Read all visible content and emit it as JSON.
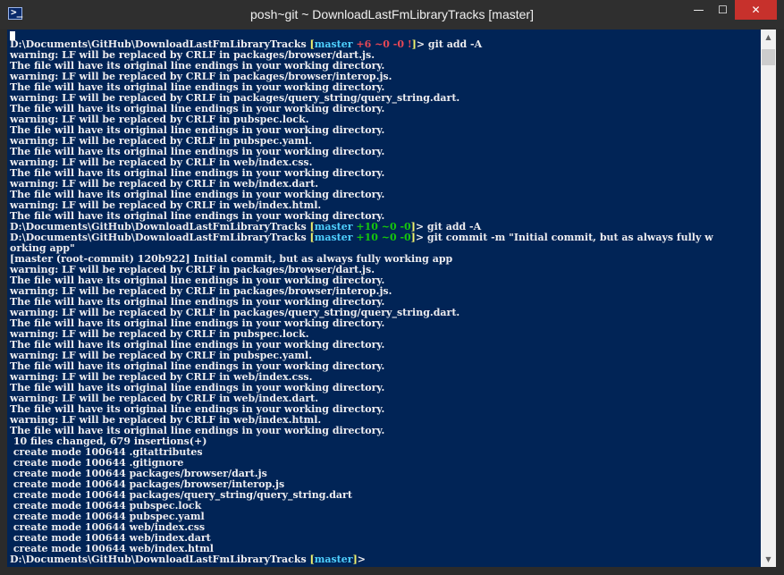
{
  "window": {
    "title": "posh~git ~ DownloadLastFmLibraryTracks [master]",
    "icon": "powershell-icon",
    "icon_glyph": ">_",
    "min_glyph": "—",
    "max_glyph": "☐",
    "close_glyph": "✕"
  },
  "colors": {
    "console_bg": "#012456",
    "text": "#eeedf0",
    "bracket_yellow": "#f2f26c",
    "branch_cyan": "#4fd0ff",
    "added_green": "#16c60c",
    "deleted_red": "#e74856"
  },
  "terminal": {
    "lines": [
      [
        {
          "t": "D:\\Documents\\GitHub\\DownloadLastFmLibraryTracks "
        },
        {
          "t": "[",
          "c": "yel"
        },
        {
          "t": "master",
          "c": "cyan"
        },
        {
          "t": " +6 ~0 -0 !",
          "c": "red"
        },
        {
          "t": "]",
          "c": "yel"
        },
        {
          "t": "> git add -A"
        }
      ],
      [
        {
          "t": "warning: LF will be replaced by CRLF in packages/browser/dart.js."
        }
      ],
      [
        {
          "t": "The file will have its original line endings in your working directory."
        }
      ],
      [
        {
          "t": "warning: LF will be replaced by CRLF in packages/browser/interop.js."
        }
      ],
      [
        {
          "t": "The file will have its original line endings in your working directory."
        }
      ],
      [
        {
          "t": "warning: LF will be replaced by CRLF in packages/query_string/query_string.dart."
        }
      ],
      [
        {
          "t": "The file will have its original line endings in your working directory."
        }
      ],
      [
        {
          "t": "warning: LF will be replaced by CRLF in pubspec.lock."
        }
      ],
      [
        {
          "t": "The file will have its original line endings in your working directory."
        }
      ],
      [
        {
          "t": "warning: LF will be replaced by CRLF in pubspec.yaml."
        }
      ],
      [
        {
          "t": "The file will have its original line endings in your working directory."
        }
      ],
      [
        {
          "t": "warning: LF will be replaced by CRLF in web/index.css."
        }
      ],
      [
        {
          "t": "The file will have its original line endings in your working directory."
        }
      ],
      [
        {
          "t": "warning: LF will be replaced by CRLF in web/index.dart."
        }
      ],
      [
        {
          "t": "The file will have its original line endings in your working directory."
        }
      ],
      [
        {
          "t": "warning: LF will be replaced by CRLF in web/index.html."
        }
      ],
      [
        {
          "t": "The file will have its original line endings in your working directory."
        }
      ],
      [
        {
          "t": "D:\\Documents\\GitHub\\DownloadLastFmLibraryTracks "
        },
        {
          "t": "[",
          "c": "yel"
        },
        {
          "t": "master",
          "c": "cyan"
        },
        {
          "t": " +10 ~0 -0",
          "c": "grn"
        },
        {
          "t": "]",
          "c": "yel"
        },
        {
          "t": "> git add -A"
        }
      ],
      [
        {
          "t": "D:\\Documents\\GitHub\\DownloadLastFmLibraryTracks "
        },
        {
          "t": "[",
          "c": "yel"
        },
        {
          "t": "master",
          "c": "cyan"
        },
        {
          "t": " +10 ~0 -0",
          "c": "grn"
        },
        {
          "t": "]",
          "c": "yel"
        },
        {
          "t": "> git commit -m \"Initial commit, but as always fully w"
        }
      ],
      [
        {
          "t": "orking app\""
        }
      ],
      [
        {
          "t": "[master (root-commit) 120b922] Initial commit, but as always fully working app"
        }
      ],
      [
        {
          "t": "warning: LF will be replaced by CRLF in packages/browser/dart.js."
        }
      ],
      [
        {
          "t": "The file will have its original line endings in your working directory."
        }
      ],
      [
        {
          "t": "warning: LF will be replaced by CRLF in packages/browser/interop.js."
        }
      ],
      [
        {
          "t": "The file will have its original line endings in your working directory."
        }
      ],
      [
        {
          "t": "warning: LF will be replaced by CRLF in packages/query_string/query_string.dart."
        }
      ],
      [
        {
          "t": "The file will have its original line endings in your working directory."
        }
      ],
      [
        {
          "t": "warning: LF will be replaced by CRLF in pubspec.lock."
        }
      ],
      [
        {
          "t": "The file will have its original line endings in your working directory."
        }
      ],
      [
        {
          "t": "warning: LF will be replaced by CRLF in pubspec.yaml."
        }
      ],
      [
        {
          "t": "The file will have its original line endings in your working directory."
        }
      ],
      [
        {
          "t": "warning: LF will be replaced by CRLF in web/index.css."
        }
      ],
      [
        {
          "t": "The file will have its original line endings in your working directory."
        }
      ],
      [
        {
          "t": "warning: LF will be replaced by CRLF in web/index.dart."
        }
      ],
      [
        {
          "t": "The file will have its original line endings in your working directory."
        }
      ],
      [
        {
          "t": "warning: LF will be replaced by CRLF in web/index.html."
        }
      ],
      [
        {
          "t": "The file will have its original line endings in your working directory."
        }
      ],
      [
        {
          "t": " 10 files changed, 679 insertions(+)"
        }
      ],
      [
        {
          "t": " create mode 100644 .gitattributes"
        }
      ],
      [
        {
          "t": " create mode 100644 .gitignore"
        }
      ],
      [
        {
          "t": " create mode 100644 packages/browser/dart.js"
        }
      ],
      [
        {
          "t": " create mode 100644 packages/browser/interop.js"
        }
      ],
      [
        {
          "t": " create mode 100644 packages/query_string/query_string.dart"
        }
      ],
      [
        {
          "t": " create mode 100644 pubspec.lock"
        }
      ],
      [
        {
          "t": " create mode 100644 pubspec.yaml"
        }
      ],
      [
        {
          "t": " create mode 100644 web/index.css"
        }
      ],
      [
        {
          "t": " create mode 100644 web/index.dart"
        }
      ],
      [
        {
          "t": " create mode 100644 web/index.html"
        }
      ],
      [
        {
          "t": "D:\\Documents\\GitHub\\DownloadLastFmLibraryTracks "
        },
        {
          "t": "[",
          "c": "yel"
        },
        {
          "t": "master",
          "c": "cyan"
        },
        {
          "t": "]",
          "c": "yel"
        },
        {
          "t": ">"
        }
      ]
    ]
  },
  "scrollbar": {
    "up_glyph": "▲",
    "down_glyph": "▼"
  }
}
